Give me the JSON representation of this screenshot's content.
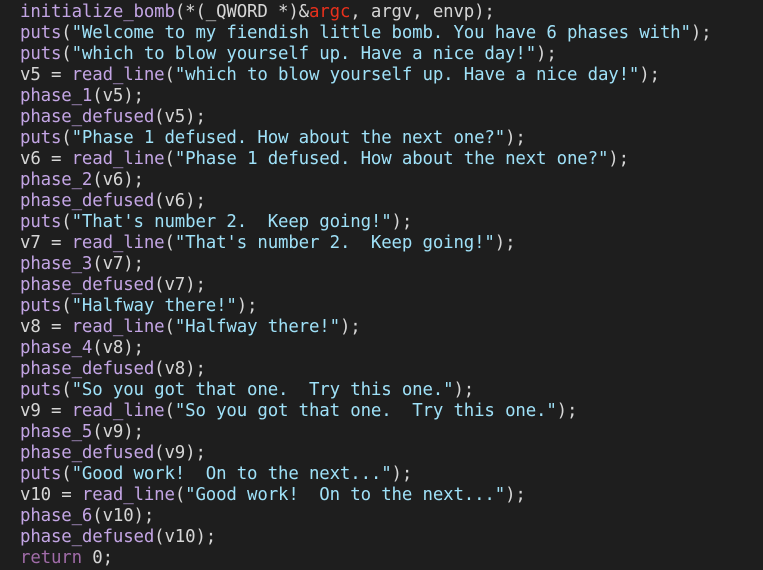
{
  "colors": {
    "background": "#1e1e1e",
    "text": "#d6d6d6",
    "function": "#c3a5e4",
    "string": "#9fe1f8",
    "keyword": "#a06ca8",
    "number": "#d6d6d6",
    "highlight": "#e8301c",
    "punctuation": "#d6d6d6"
  },
  "code_lines": [
    [
      {
        "t": "fn",
        "v": "initialize_bomb"
      },
      {
        "t": "p",
        "v": "(*(_QWORD *)&"
      },
      {
        "t": "hl",
        "v": "argc"
      },
      {
        "t": "p",
        "v": ", argv, envp);"
      }
    ],
    [
      {
        "t": "fn",
        "v": "puts"
      },
      {
        "t": "p",
        "v": "("
      },
      {
        "t": "str",
        "v": "\"Welcome to my fiendish little bomb. You have 6 phases with\""
      },
      {
        "t": "p",
        "v": ");"
      }
    ],
    [
      {
        "t": "fn",
        "v": "puts"
      },
      {
        "t": "p",
        "v": "("
      },
      {
        "t": "str",
        "v": "\"which to blow yourself up. Have a nice day!\""
      },
      {
        "t": "p",
        "v": ");"
      }
    ],
    [
      {
        "t": "p",
        "v": "v5 = "
      },
      {
        "t": "fn",
        "v": "read_line"
      },
      {
        "t": "p",
        "v": "("
      },
      {
        "t": "str",
        "v": "\"which to blow yourself up. Have a nice day!\""
      },
      {
        "t": "p",
        "v": ");"
      }
    ],
    [
      {
        "t": "fn",
        "v": "phase_1"
      },
      {
        "t": "p",
        "v": "(v5);"
      }
    ],
    [
      {
        "t": "fn",
        "v": "phase_defused"
      },
      {
        "t": "p",
        "v": "(v5);"
      }
    ],
    [
      {
        "t": "fn",
        "v": "puts"
      },
      {
        "t": "p",
        "v": "("
      },
      {
        "t": "str",
        "v": "\"Phase 1 defused. How about the next one?\""
      },
      {
        "t": "p",
        "v": ");"
      }
    ],
    [
      {
        "t": "p",
        "v": "v6 = "
      },
      {
        "t": "fn",
        "v": "read_line"
      },
      {
        "t": "p",
        "v": "("
      },
      {
        "t": "str",
        "v": "\"Phase 1 defused. How about the next one?\""
      },
      {
        "t": "p",
        "v": ");"
      }
    ],
    [
      {
        "t": "fn",
        "v": "phase_2"
      },
      {
        "t": "p",
        "v": "(v6);"
      }
    ],
    [
      {
        "t": "fn",
        "v": "phase_defused"
      },
      {
        "t": "p",
        "v": "(v6);"
      }
    ],
    [
      {
        "t": "fn",
        "v": "puts"
      },
      {
        "t": "p",
        "v": "("
      },
      {
        "t": "str",
        "v": "\"That's number 2.  Keep going!\""
      },
      {
        "t": "p",
        "v": ");"
      }
    ],
    [
      {
        "t": "p",
        "v": "v7 = "
      },
      {
        "t": "fn",
        "v": "read_line"
      },
      {
        "t": "p",
        "v": "("
      },
      {
        "t": "str",
        "v": "\"That's number 2.  Keep going!\""
      },
      {
        "t": "p",
        "v": ");"
      }
    ],
    [
      {
        "t": "fn",
        "v": "phase_3"
      },
      {
        "t": "p",
        "v": "(v7);"
      }
    ],
    [
      {
        "t": "fn",
        "v": "phase_defused"
      },
      {
        "t": "p",
        "v": "(v7);"
      }
    ],
    [
      {
        "t": "fn",
        "v": "puts"
      },
      {
        "t": "p",
        "v": "("
      },
      {
        "t": "str",
        "v": "\"Halfway there!\""
      },
      {
        "t": "p",
        "v": ");"
      }
    ],
    [
      {
        "t": "p",
        "v": "v8 = "
      },
      {
        "t": "fn",
        "v": "read_line"
      },
      {
        "t": "p",
        "v": "("
      },
      {
        "t": "str",
        "v": "\"Halfway there!\""
      },
      {
        "t": "p",
        "v": ");"
      }
    ],
    [
      {
        "t": "fn",
        "v": "phase_4"
      },
      {
        "t": "p",
        "v": "(v8);"
      }
    ],
    [
      {
        "t": "fn",
        "v": "phase_defused"
      },
      {
        "t": "p",
        "v": "(v8);"
      }
    ],
    [
      {
        "t": "fn",
        "v": "puts"
      },
      {
        "t": "p",
        "v": "("
      },
      {
        "t": "str",
        "v": "\"So you got that one.  Try this one.\""
      },
      {
        "t": "p",
        "v": ");"
      }
    ],
    [
      {
        "t": "p",
        "v": "v9 = "
      },
      {
        "t": "fn",
        "v": "read_line"
      },
      {
        "t": "p",
        "v": "("
      },
      {
        "t": "str",
        "v": "\"So you got that one.  Try this one.\""
      },
      {
        "t": "p",
        "v": ");"
      }
    ],
    [
      {
        "t": "fn",
        "v": "phase_5"
      },
      {
        "t": "p",
        "v": "(v9);"
      }
    ],
    [
      {
        "t": "fn",
        "v": "phase_defused"
      },
      {
        "t": "p",
        "v": "(v9);"
      }
    ],
    [
      {
        "t": "fn",
        "v": "puts"
      },
      {
        "t": "p",
        "v": "("
      },
      {
        "t": "str",
        "v": "\"Good work!  On to the next...\""
      },
      {
        "t": "p",
        "v": ");"
      }
    ],
    [
      {
        "t": "p",
        "v": "v10 = "
      },
      {
        "t": "fn",
        "v": "read_line"
      },
      {
        "t": "p",
        "v": "("
      },
      {
        "t": "str",
        "v": "\"Good work!  On to the next...\""
      },
      {
        "t": "p",
        "v": ");"
      }
    ],
    [
      {
        "t": "fn",
        "v": "phase_6"
      },
      {
        "t": "p",
        "v": "(v10);"
      }
    ],
    [
      {
        "t": "fn",
        "v": "phase_defused"
      },
      {
        "t": "p",
        "v": "(v10);"
      }
    ],
    [
      {
        "t": "kw",
        "v": "return"
      },
      {
        "t": "p",
        "v": " "
      },
      {
        "t": "num",
        "v": "0"
      },
      {
        "t": "p",
        "v": ";"
      }
    ]
  ]
}
